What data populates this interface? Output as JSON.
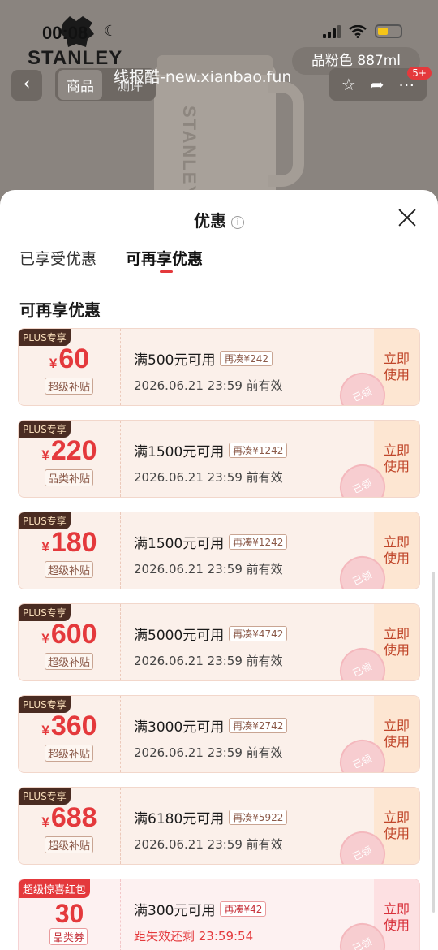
{
  "status_bar": {
    "time": "00:08",
    "moon_icon": "moon-icon"
  },
  "brand": {
    "name": "STANLEY"
  },
  "product": {
    "variant": "晶粉色 887ml",
    "cup_brand": "STANLEY"
  },
  "nav": {
    "back_icon": "chevron-left-icon",
    "tab_product": "商品",
    "tab_review": "测评",
    "cart_count": "5+"
  },
  "watermark": "线报酷-new.xianbao.fun",
  "sheet": {
    "title": "优惠",
    "info_icon": "i",
    "tabs": [
      "已享受优惠",
      "可再享优惠"
    ],
    "section_title": "可再享优惠",
    "use_label": "立即\n使用",
    "claimed_stamp": "已领"
  },
  "coupons": [
    {
      "tag": "PLUS专享",
      "currency": "¥",
      "amount": "60",
      "label": "超级补贴",
      "condition": "满500元可用",
      "add_more": "再凑¥242",
      "validity": "2026.06.21 23:59 前有效"
    },
    {
      "tag": "PLUS专享",
      "currency": "¥",
      "amount": "220",
      "label": "品类补贴",
      "condition": "满1500元可用",
      "add_more": "再凑¥1242",
      "validity": "2026.06.21 23:59 前有效"
    },
    {
      "tag": "PLUS专享",
      "currency": "¥",
      "amount": "180",
      "label": "超级补贴",
      "condition": "满1500元可用",
      "add_more": "再凑¥1242",
      "validity": "2026.06.21 23:59 前有效"
    },
    {
      "tag": "PLUS专享",
      "currency": "¥",
      "amount": "600",
      "label": "超级补贴",
      "condition": "满5000元可用",
      "add_more": "再凑¥4742",
      "validity": "2026.06.21 23:59 前有效"
    },
    {
      "tag": "PLUS专享",
      "currency": "¥",
      "amount": "360",
      "label": "超级补贴",
      "condition": "满3000元可用",
      "add_more": "再凑¥2742",
      "validity": "2026.06.21 23:59 前有效"
    },
    {
      "tag": "PLUS专享",
      "currency": "¥",
      "amount": "688",
      "label": "超级补贴",
      "condition": "满6180元可用",
      "add_more": "再凑¥5922",
      "validity": "2026.06.21 23:59 前有效"
    }
  ],
  "red_packet": {
    "tag": "超级惊喜红包",
    "amount": "30",
    "label": "品类券",
    "condition": "满300元可用",
    "add_more": "再凑¥42",
    "countdown": "距失效还剩 23:59:54"
  },
  "colors": {
    "accent_red": "#e4393c",
    "plus_dark": "#4a2c22",
    "use_bg": "#fde6d2"
  }
}
